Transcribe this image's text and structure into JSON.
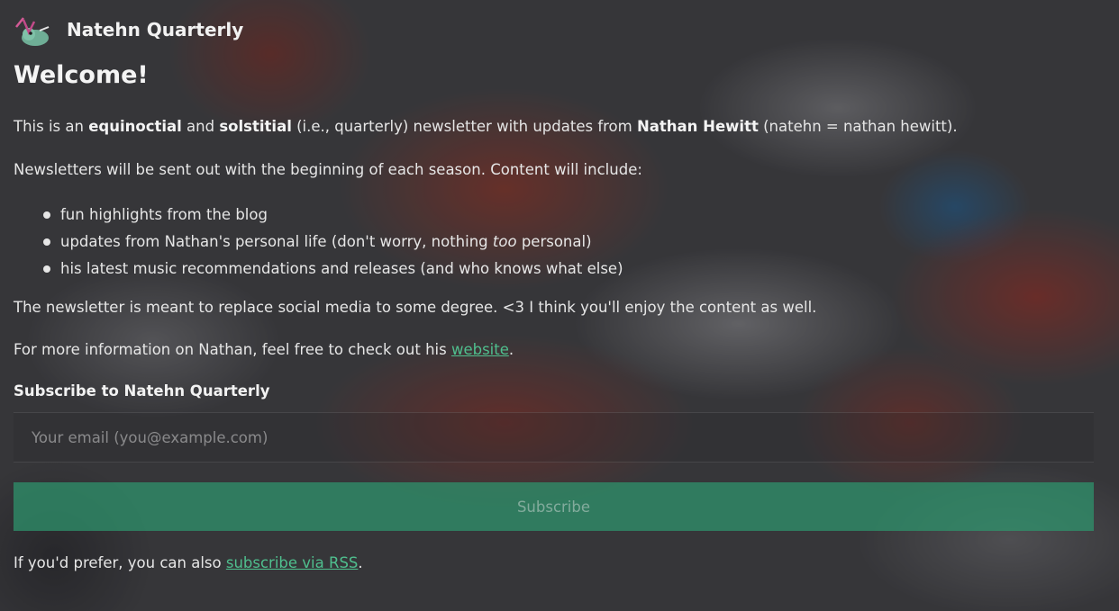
{
  "header": {
    "site_name": "Natehn Quarterly",
    "logo_icon": "bird-logo-icon"
  },
  "main": {
    "heading": "Welcome!",
    "intro": {
      "t1": "This is an ",
      "b1": "equinoctial",
      "t2": " and ",
      "b2": "solstitial",
      "t3": " (i.e., quarterly) newsletter with updates from ",
      "b3": "Nathan Hewitt",
      "t4": " (natehn = nathan hewitt)."
    },
    "schedule": "Newsletters will be sent out with the beginning of each season. Content will include:",
    "content_items": [
      {
        "text": "fun highlights from the blog"
      },
      {
        "t1": "updates from Nathan's personal life (don't worry, nothing ",
        "em": "too",
        "t2": " personal)"
      },
      {
        "text": "his latest music recommendations and releases (and who knows what else)"
      }
    ],
    "purpose": "The newsletter is meant to replace social media to some degree. <3 I think you'll enjoy the content as well.",
    "more_info": {
      "before": "For more information on Nathan, feel free to check out his ",
      "link": "website",
      "after": "."
    }
  },
  "subscribe": {
    "title": "Subscribe to Natehn Quarterly",
    "email_placeholder": "Your email (you@example.com)",
    "button_label": "Subscribe",
    "rss": {
      "before": "If you'd prefer, you can also ",
      "link": "subscribe via RSS",
      "after": "."
    }
  },
  "colors": {
    "link": "#4fbf8e",
    "button": "#2e966e"
  }
}
